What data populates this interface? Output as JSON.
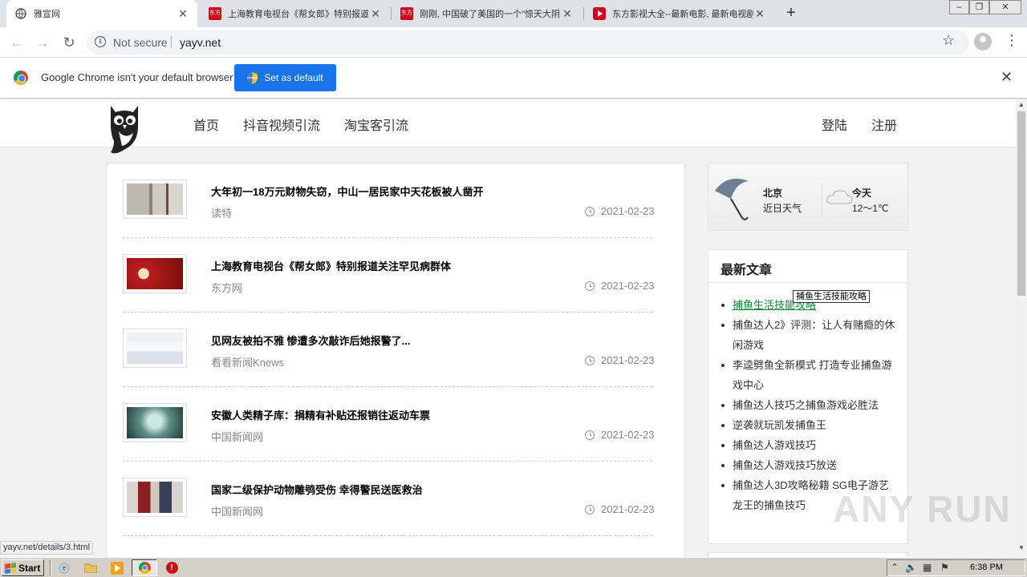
{
  "browser": {
    "tabs": [
      {
        "title": "雅宣网",
        "active": true,
        "icon": "globe-icon"
      },
      {
        "title": "上海教育电视台《帮女郎》特别报道关",
        "active": false,
        "icon": "dongfang-icon",
        "icon_text": "东方"
      },
      {
        "title": "刚刚, 中国破了美国的一个\"惊天大阴",
        "active": false,
        "icon": "dongfang-icon",
        "icon_text": "东方"
      },
      {
        "title": "东方影视大全--最新电影, 最新电视剧",
        "active": false,
        "icon": "play-icon"
      }
    ],
    "omnibox": {
      "security": "Not secure",
      "url": "yayv.net"
    },
    "infobar": {
      "message": "Google Chrome isn't your default browser",
      "button": "Set as default"
    },
    "status_url": "yayv.net/details/3.html"
  },
  "site": {
    "nav": [
      "首页",
      "抖音视频引流",
      "淘宝客引流"
    ],
    "login": "登陆",
    "register": "注册",
    "articles": [
      {
        "title": "大年初一18万元财物失窃，中山一居民家中天花板被人凿开",
        "source": "读特",
        "date": "2021-02-23"
      },
      {
        "title": "上海教育电视台《帮女郎》特别报道关注罕见病群体",
        "source": "东方网",
        "date": "2021-02-23"
      },
      {
        "title": "见网友被拍不雅 惨遭多次敲诈后她报警了...",
        "source": "看看新闻Knews",
        "date": "2021-02-23"
      },
      {
        "title": "安徽人类精子库：捐精有补贴还报销往返动车票",
        "source": "中国新闻网",
        "date": "2021-02-23"
      },
      {
        "title": "国家二级保护动物雕鸮受伤 幸得警民送医救治",
        "source": "中国新闻网",
        "date": "2021-02-23"
      }
    ],
    "weather": {
      "city": "北京",
      "label": "近日天气",
      "day": "今天",
      "temp": "12～1℃"
    },
    "latest": {
      "title": "最新文章",
      "items": [
        "捕鱼生活技能攻略",
        "捕鱼达人2》评测：让人有赌瘾的休闲游戏",
        "李逵劈鱼全新模式 打造专业捕鱼游戏中心",
        "捕鱼达人技巧之捕鱼游戏必胜法",
        "逆袭就玩凯发捕鱼王",
        "捕鱼达人游戏技巧",
        "捕鱼达人游戏技巧放送",
        "捕鱼达人3D攻略秘籍 SG电子游艺龙王的捕鱼技巧"
      ],
      "tooltip": "捕鱼生活技能攻略"
    }
  },
  "watermark": "ANY RUN",
  "taskbar": {
    "start": "Start",
    "clock": "6:38 PM"
  }
}
